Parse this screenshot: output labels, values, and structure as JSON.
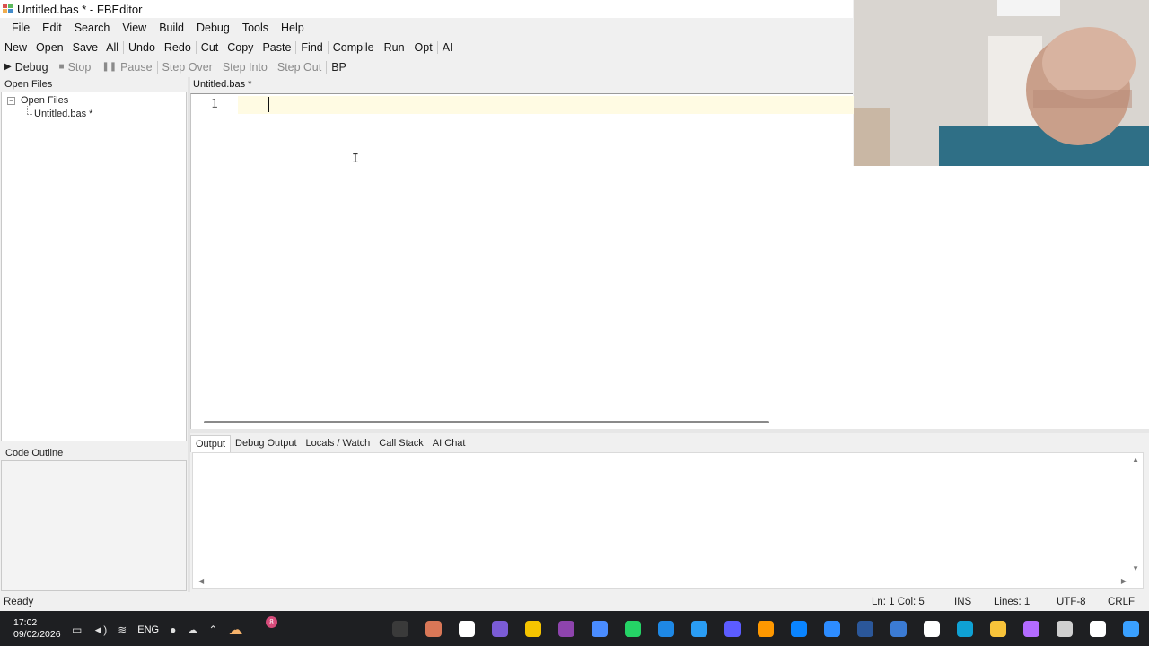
{
  "window": {
    "title": "Untitled.bas * - FBEditor"
  },
  "menu": [
    "File",
    "Edit",
    "Search",
    "View",
    "Build",
    "Debug",
    "Tools",
    "Help"
  ],
  "toolbar": {
    "group1": [
      "New",
      "Open",
      "Save",
      "All"
    ],
    "group2": [
      "Undo",
      "Redo"
    ],
    "group3": [
      "Cut",
      "Copy",
      "Paste"
    ],
    "group4": [
      "Find"
    ],
    "group5": [
      "Compile",
      "Run",
      "Opt"
    ],
    "group6": [
      "AI"
    ]
  },
  "debugbar": {
    "debug": "Debug",
    "stop": "Stop",
    "pause": "Pause",
    "step_over": "Step Over",
    "step_into": "Step Into",
    "step_out": "Step Out",
    "bp": "BP"
  },
  "left": {
    "open_files_header": "Open Files",
    "tree_root": "Open Files",
    "tree_child": "Untitled.bas *",
    "outline_header": "Code Outline"
  },
  "editor": {
    "tab": "Untitled.bas *",
    "line_number": "1",
    "content": ""
  },
  "output": {
    "tabs": [
      "Output",
      "Debug Output",
      "Locals / Watch",
      "Call Stack",
      "AI Chat"
    ],
    "active_tab": "Output"
  },
  "status": {
    "ready": "Ready",
    "ln_col": "Ln: 1  Col: 5",
    "mode": "INS",
    "lines": "Lines: 1",
    "encoding": "UTF-8",
    "eol": "CRLF"
  },
  "taskbar": {
    "time": "17:02",
    "date": "09/02/2026",
    "lang": "ENG",
    "badge": "8",
    "apps": [
      {
        "name": "obs-icon",
        "color": "#3a3a3a"
      },
      {
        "name": "claude-icon",
        "color": "#d97757"
      },
      {
        "name": "chatgpt-icon",
        "color": "#ffffff"
      },
      {
        "name": "app-grid-icon",
        "color": "#7b5cd6"
      },
      {
        "name": "pen-icon",
        "color": "#f5c400"
      },
      {
        "name": "media-player-icon",
        "color": "#8e44ad"
      },
      {
        "name": "gemini-icon",
        "color": "#4a8cff"
      },
      {
        "name": "whatsapp-icon",
        "color": "#25d366"
      },
      {
        "name": "document-icon",
        "color": "#1e88e5"
      },
      {
        "name": "photos-icon",
        "color": "#2a9df4"
      },
      {
        "name": "camera-app-icon",
        "color": "#5c5cff"
      },
      {
        "name": "sublime-icon",
        "color": "#ff9800"
      },
      {
        "name": "vscode-icon",
        "color": "#0a84ff"
      },
      {
        "name": "zoom-icon",
        "color": "#2d8cff"
      },
      {
        "name": "word-icon",
        "color": "#2b579a"
      },
      {
        "name": "vscode-alt-icon",
        "color": "#3b7bd4"
      },
      {
        "name": "store-icon",
        "color": "#ffffff"
      },
      {
        "name": "edge-icon",
        "color": "#0fa1d4"
      },
      {
        "name": "folder-icon",
        "color": "#f8c33a"
      },
      {
        "name": "copilot-icon",
        "color": "#b36bff"
      },
      {
        "name": "window-icon",
        "color": "#cfcfcf"
      },
      {
        "name": "search-icon",
        "color": "#ffffff"
      },
      {
        "name": "start-icon",
        "color": "#3aa0ff"
      }
    ]
  }
}
